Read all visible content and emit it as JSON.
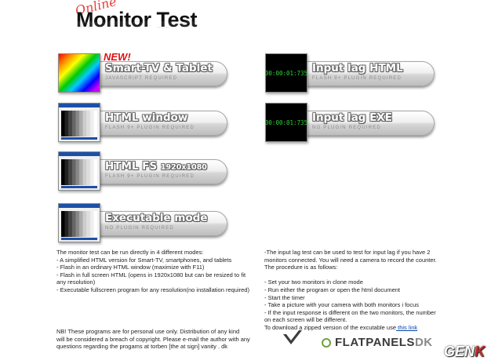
{
  "header": {
    "logo_script": "Online",
    "title": "Monitor Test"
  },
  "buttons_left": [
    {
      "label": "Smart-TV & Tablet",
      "label_small": "",
      "sub": "JAVASCRIPT REQUIRED",
      "badge": "NEW!",
      "thumb": "rainbow"
    },
    {
      "label": "HTML window",
      "label_small": "",
      "sub": "FLASH 9+ PLUGIN REQUIRED",
      "badge": "",
      "thumb": "grayscale"
    },
    {
      "label": "HTML FS",
      "label_small": "1920x1080",
      "sub": "FLASH 9+ PLUGIN REQUIRED",
      "badge": "",
      "thumb": "grayscale"
    },
    {
      "label": "Executable mode",
      "label_small": "",
      "sub": "NO PLUGIN REQUIRED",
      "badge": "",
      "thumb": "grayscale"
    }
  ],
  "buttons_right": [
    {
      "label": "Input lag HTML",
      "sub": "FLASH 9+ PLUGIN REQUIRED",
      "timer": "00:00:01:735"
    },
    {
      "label": "Input lag EXE",
      "sub": "NO PLUGIN REQUIRED",
      "timer": "00:00:01:735"
    }
  ],
  "left_text": {
    "lines": [
      "The monitor test can be run directly in 4 different modes:",
      "- A simplified HTML version for Smart-TV, smartphones, and tablets",
      "- Flash in an ordinary HTML window (maximize with F11)",
      "- Flash in full screen HTML (opens in 1920x1080 but can be resized to fit",
      "any resolution)",
      "- Executable fullscreen program for any resolution(no installation required)"
    ]
  },
  "right_text": {
    "intro_1": "-The input lag test can be used to test for input lag if you have 2",
    "intro_2": "monitors connected. You will need a camera to record the counter.",
    "intro_3": "The procedure is as follows:",
    "steps": [
      "- Set your two monitors in clone mode",
      "- Run either the program or open the html document",
      "- Start the timer",
      "- Take a picture with your camera with both monitors i focus",
      "- If the input response is different on the two monitors, the number",
      "on each screen will be different."
    ],
    "download_text": "To download a zipped version of the excutable use",
    "download_link": " this link"
  },
  "note": {
    "line1": "NB! These programs are for personal use only. Distribution of any kind",
    "line2": "will be considered a breach of copyright. Please e-mail the author with any",
    "line3": "questions regarding the progams at torben [the at sign] vanity . dk"
  },
  "footer": {
    "brand_main": "FLATPANELS",
    "brand_suffix": "DK",
    "watermark_main": "GEN",
    "watermark_k": "K"
  },
  "colors": {
    "new_badge": "#dd1111",
    "timer_text": "#2dd43a",
    "link": "#0645ad",
    "power": "#6aa33a"
  }
}
